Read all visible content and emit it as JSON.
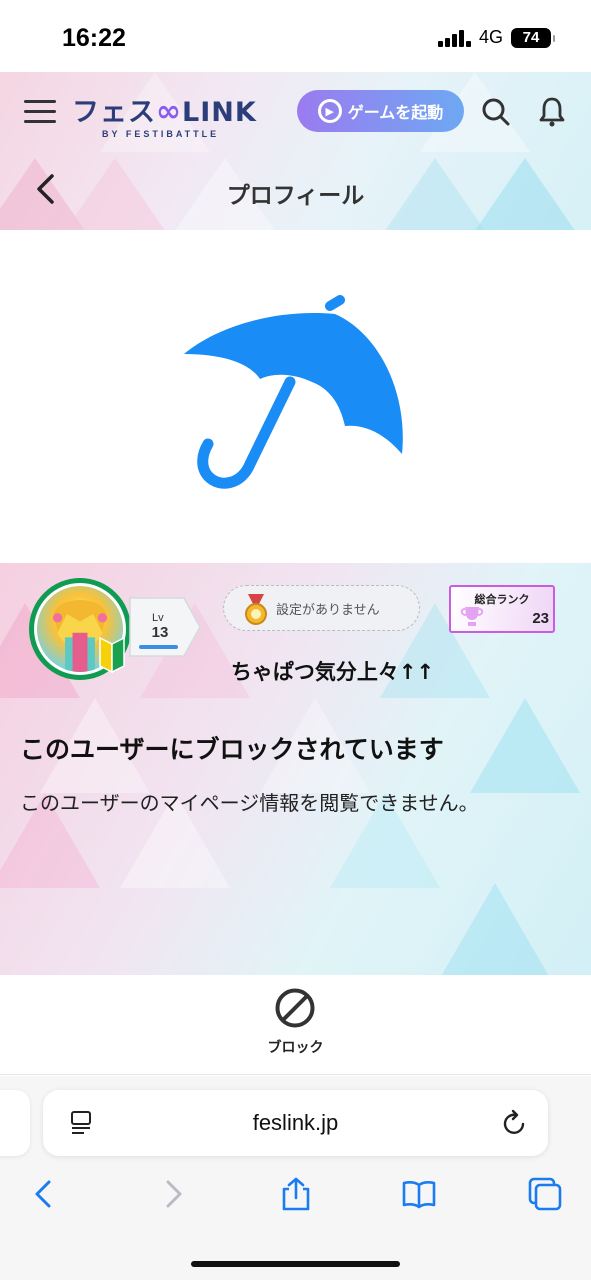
{
  "status_bar": {
    "time": "16:22",
    "network": "4G",
    "battery": "74"
  },
  "header": {
    "logo_main": "フェス",
    "logo_link": "LINK",
    "logo_sub": "BY FESTIBATTLE",
    "game_button_label": "ゲームを起動"
  },
  "titlebar": {
    "title": "プロフィール"
  },
  "profile": {
    "level_label": "Lv",
    "level_value": "13",
    "title_text": "設定がありません",
    "rank_label": "総合ランク",
    "rank_value": "23",
    "nickname": "ちゃぱつ気分上々↑↑"
  },
  "blocked": {
    "heading": "このユーザーにブロックされています",
    "description": "このユーザーのマイページ情報を閲覧できません。"
  },
  "actions": {
    "block_label": "ブロック"
  },
  "browser": {
    "url": "feslink.jp"
  },
  "colors": {
    "accent_purple": "#9b7bf0",
    "accent_blue": "#6ea8f2",
    "umbrella_blue": "#1a8cf5",
    "avatar_ring": "#0f9c52",
    "rank_border": "#c85de0"
  },
  "icons": [
    "menu-icon",
    "search-icon",
    "bell-icon",
    "chevron-left-icon",
    "umbrella-icon",
    "medal-icon",
    "trophy-icon",
    "beginner-mark-icon",
    "block-icon",
    "reader-icon",
    "reload-icon",
    "back-icon",
    "forward-icon",
    "share-icon",
    "bookmarks-icon",
    "tabs-icon"
  ]
}
